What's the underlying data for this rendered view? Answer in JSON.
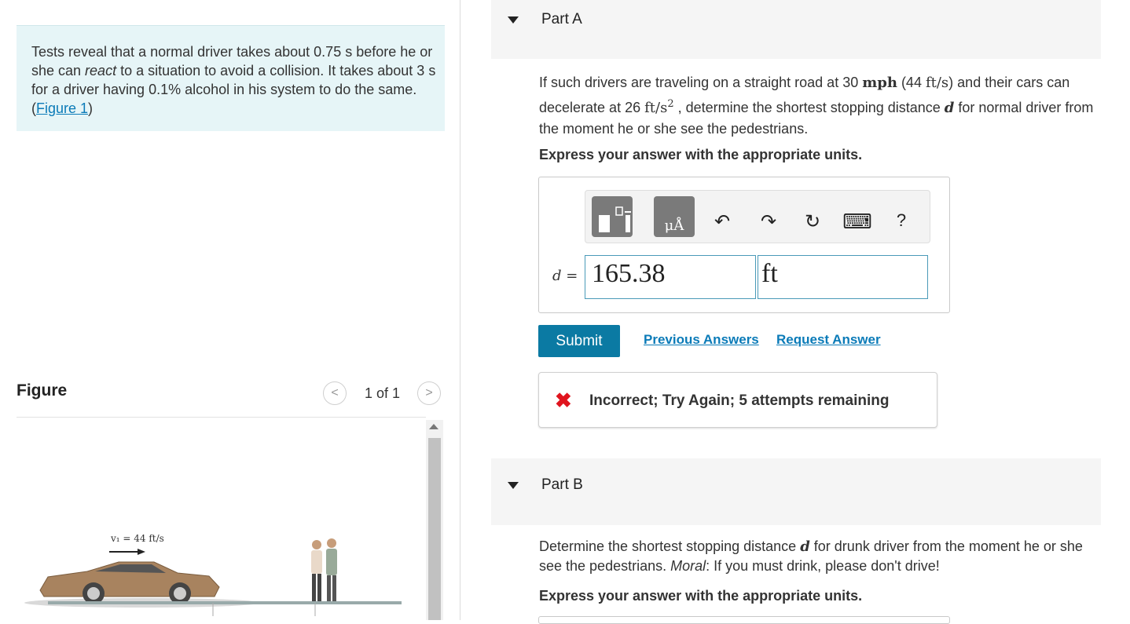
{
  "problem": {
    "text_before_react": "Tests reveal that a normal driver takes about 0.75 s before he or she can ",
    "react_word": "react",
    "text_after_react": " to a situation to avoid a collision. It takes about 3 s for a driver having 0.1% alcohol in his system to do the same.",
    "figure_link_open": "(",
    "figure_link": "Figure 1",
    "figure_link_close": ")"
  },
  "figure": {
    "label": "Figure",
    "prev": "<",
    "next": ">",
    "pager": "1 of 1",
    "velocity_label": "v₁ = 44 ft/s"
  },
  "partA": {
    "title": "Part A",
    "q1": "If such drivers are traveling on a straight road at 30 ",
    "mph": "mph",
    "q2": " (44 ",
    "ftps": "ft/s",
    "q3": ") and their cars can decelerate at 26 ",
    "ftps2": "ft/s",
    "sq": "2",
    "q4": " , determine the shortest stopping distance ",
    "d": "d",
    "q5": " for normal driver from the moment he or she see the pedestrians.",
    "express": "Express your answer with the appropriate units.",
    "toolbar": {
      "undo": "↶",
      "redo": "↷",
      "reset": "↻",
      "keyboard": "⌨",
      "help": "?",
      "units_symbol": "μÅ"
    },
    "var_label": "d =",
    "value": "165.38",
    "unit": "ft",
    "submit": "Submit",
    "previous_answers": "Previous Answers",
    "request_answer": "Request Answer",
    "feedback_icon": "✖",
    "feedback": "Incorrect; Try Again; 5 attempts remaining"
  },
  "partB": {
    "title": "Part B",
    "q1": "Determine the shortest stopping distance ",
    "d": "d",
    "q2": " for drunk driver from the moment he or she see the pedestrians. ",
    "moral": "Moral",
    "q3": ": If you must drink, please don't drive!",
    "express": "Express your answer with the appropriate units."
  },
  "colors": {
    "accent": "#0b7aa3",
    "link": "#0b7bb8",
    "error": "#e0141e",
    "problem_bg": "#e6f5f7"
  }
}
